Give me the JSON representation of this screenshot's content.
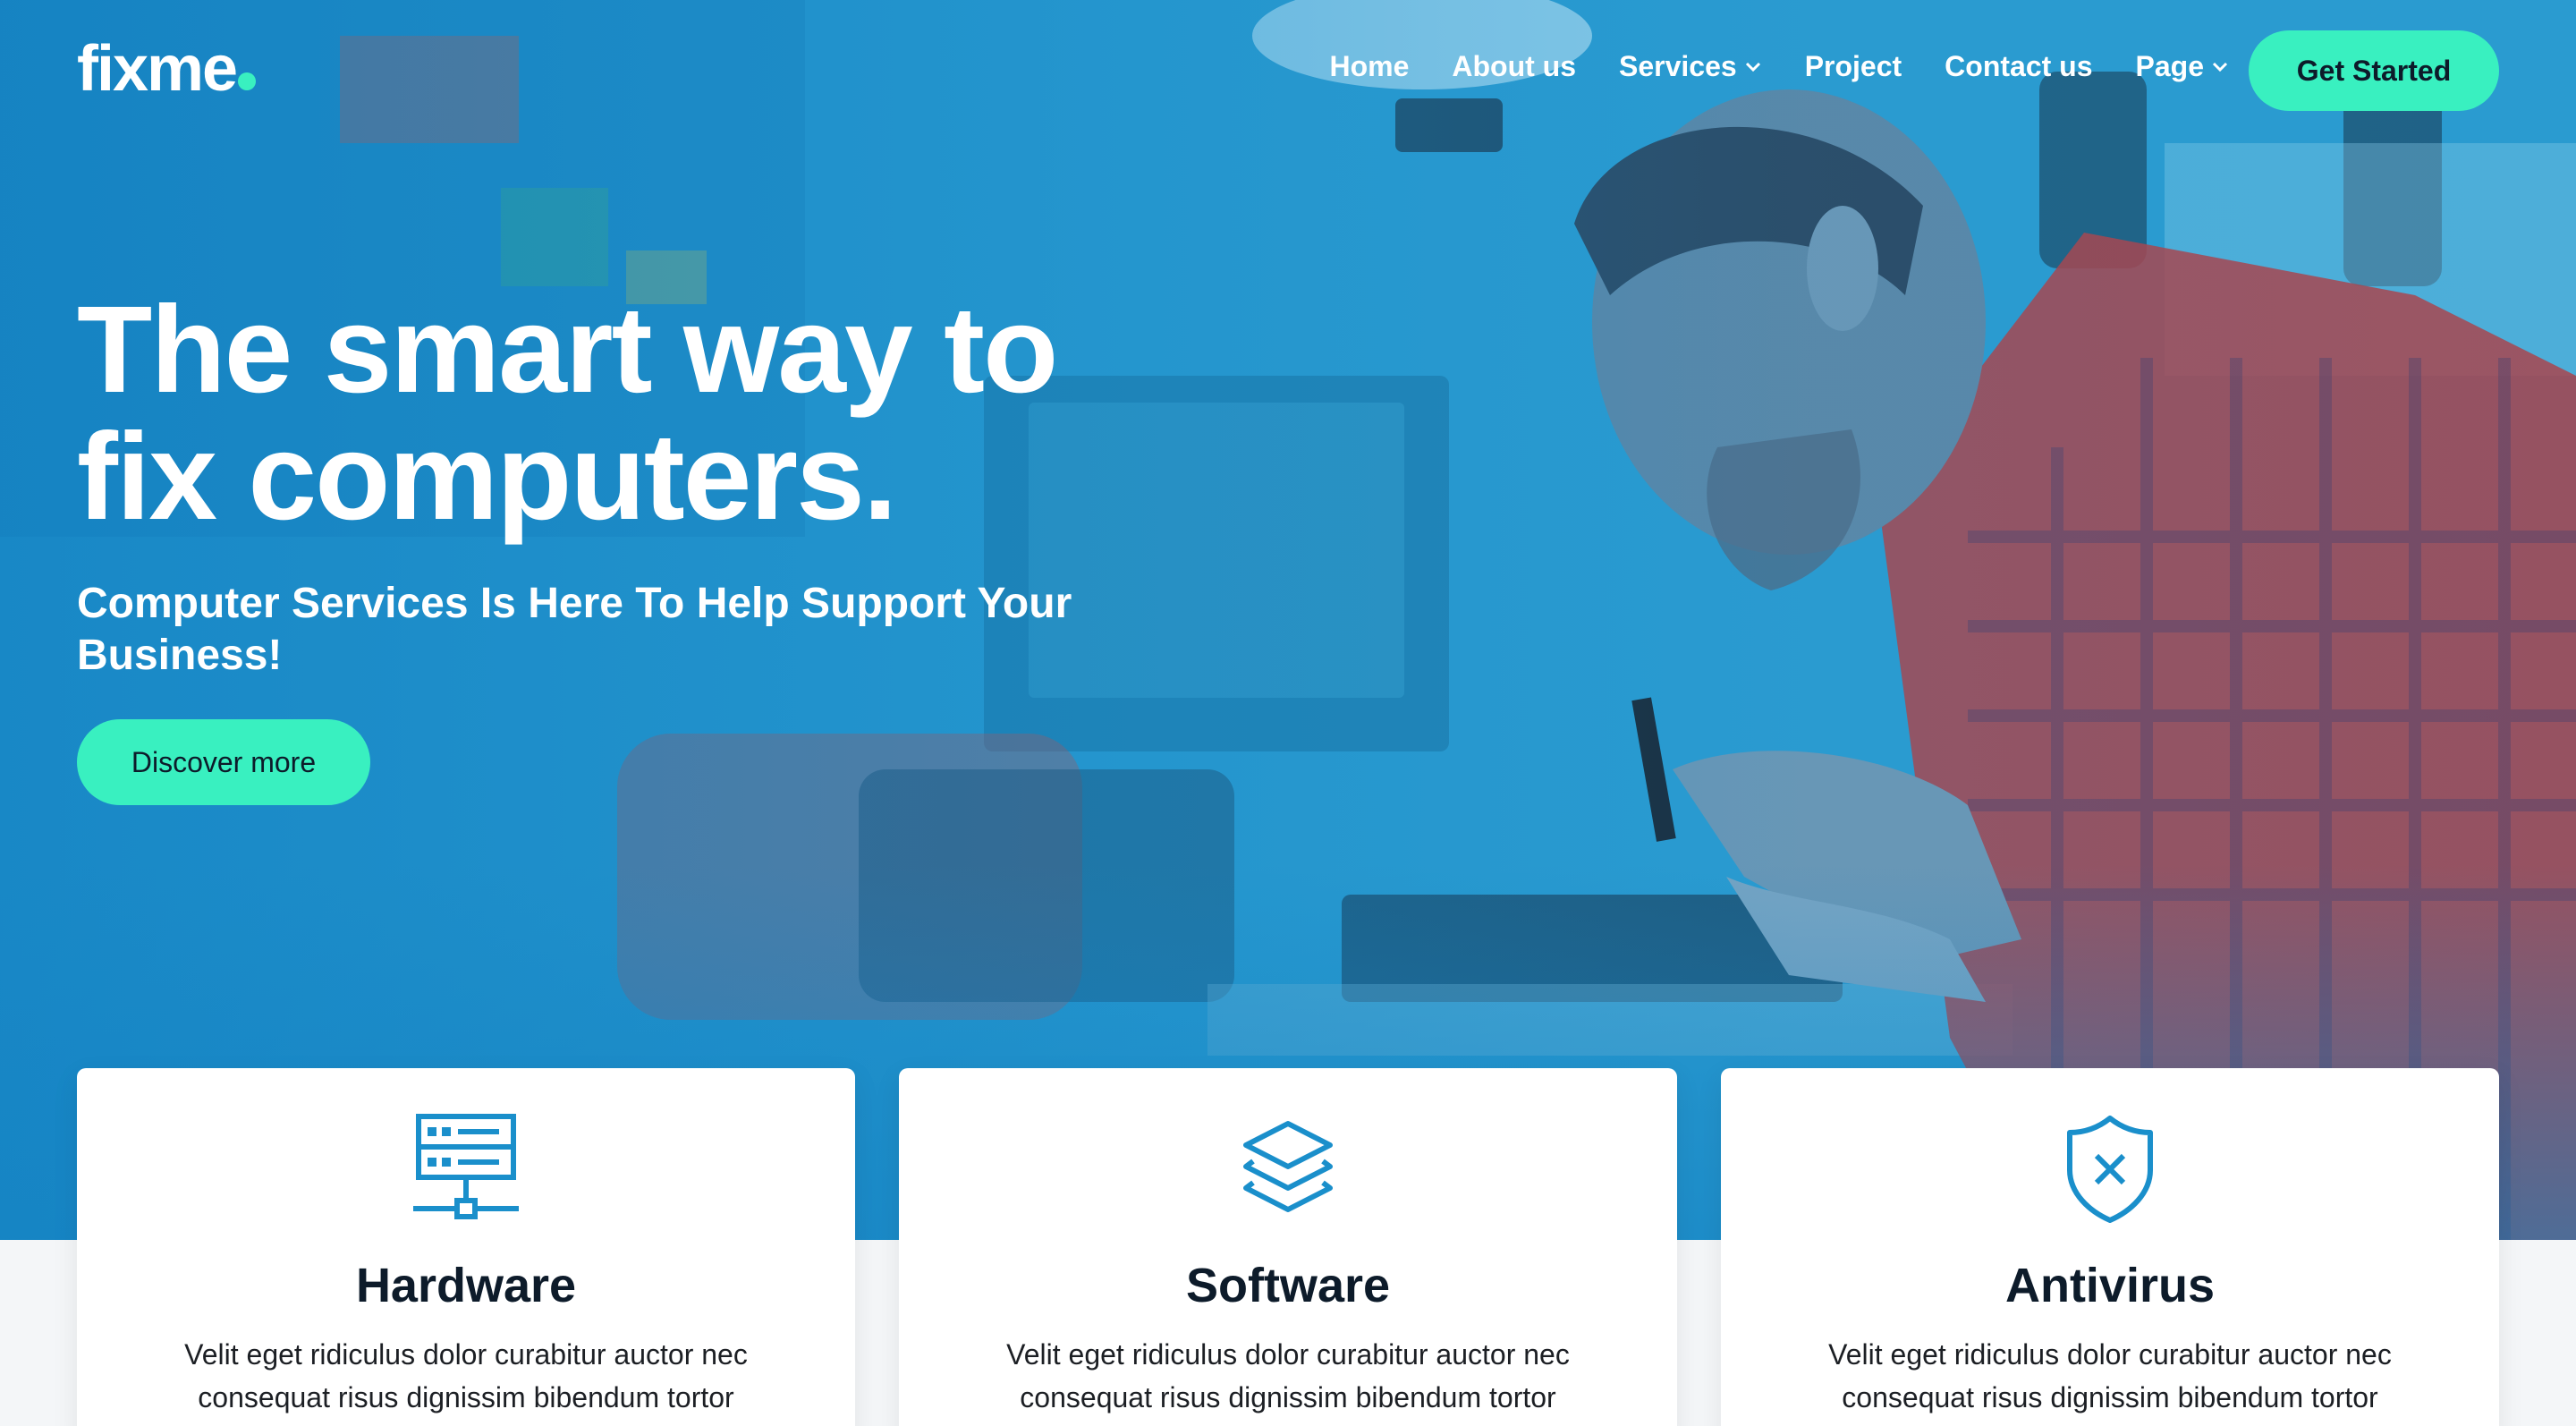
{
  "brand": {
    "logo_text": "fixme",
    "accent": "#39f0c0",
    "primary": "#1a8fcb"
  },
  "nav": {
    "items": [
      {
        "label": "Home"
      },
      {
        "label": "About us"
      },
      {
        "label": "Services",
        "has_dropdown": true
      },
      {
        "label": "Project"
      },
      {
        "label": "Contact us"
      },
      {
        "label": "Page",
        "has_dropdown": true
      }
    ],
    "cta_label": "Get Started"
  },
  "hero": {
    "title_line1": "The smart way to",
    "title_line2": "fix computers.",
    "subtitle": "Computer Services Is Here To Help Support Your Business!",
    "button_label": "Discover more"
  },
  "services": [
    {
      "icon": "server-network-icon",
      "title": "Hardware",
      "text": "Velit eget ridiculus dolor curabitur auctor nec consequat risus dignissim bibendum tortor"
    },
    {
      "icon": "layers-icon",
      "title": "Software",
      "text": "Velit eget ridiculus dolor curabitur auctor nec consequat risus dignissim bibendum tortor"
    },
    {
      "icon": "shield-x-icon",
      "title": "Antivirus",
      "text": "Velit eget ridiculus dolor curabitur auctor nec consequat risus dignissim bibendum tortor"
    }
  ]
}
